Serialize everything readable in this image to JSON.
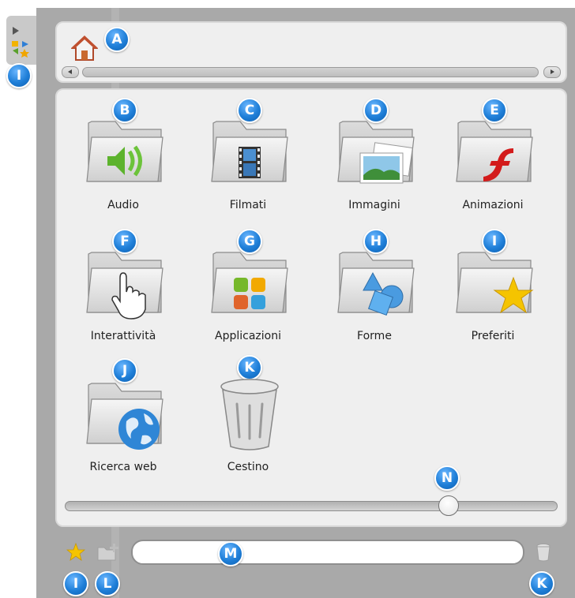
{
  "top": {
    "home_label": "Home"
  },
  "items": [
    {
      "label": "Audio",
      "marker": "B",
      "icon": "audio-folder-icon"
    },
    {
      "label": "Filmati",
      "marker": "C",
      "icon": "film-folder-icon"
    },
    {
      "label": "Immagini",
      "marker": "D",
      "icon": "images-folder-icon"
    },
    {
      "label": "Animazioni",
      "marker": "E",
      "icon": "flash-folder-icon"
    },
    {
      "label": "Interattività",
      "marker": "F",
      "icon": "hand-folder-icon"
    },
    {
      "label": "Applicazioni",
      "marker": "G",
      "icon": "apps-folder-icon"
    },
    {
      "label": "Forme",
      "marker": "H",
      "icon": "shapes-folder-icon"
    },
    {
      "label": "Preferiti",
      "marker": "I",
      "icon": "star-folder-icon"
    },
    {
      "label": "Ricerca web",
      "marker": "J",
      "icon": "globe-folder-icon"
    },
    {
      "label": "Cestino",
      "marker": "K",
      "icon": "trash-icon"
    }
  ],
  "markers": {
    "home": "A",
    "side": "I",
    "slider": "N",
    "input": "M",
    "bottom_star": "I",
    "bottom_new_folder": "L",
    "bottom_trash": "K"
  },
  "slider": {
    "value_fraction": 0.78
  },
  "bottom": {
    "input_value": ""
  },
  "colors": {
    "accent_badge": "#1f7fd8",
    "panel_bg": "#a9a9a9",
    "content_bg": "#efefef"
  }
}
